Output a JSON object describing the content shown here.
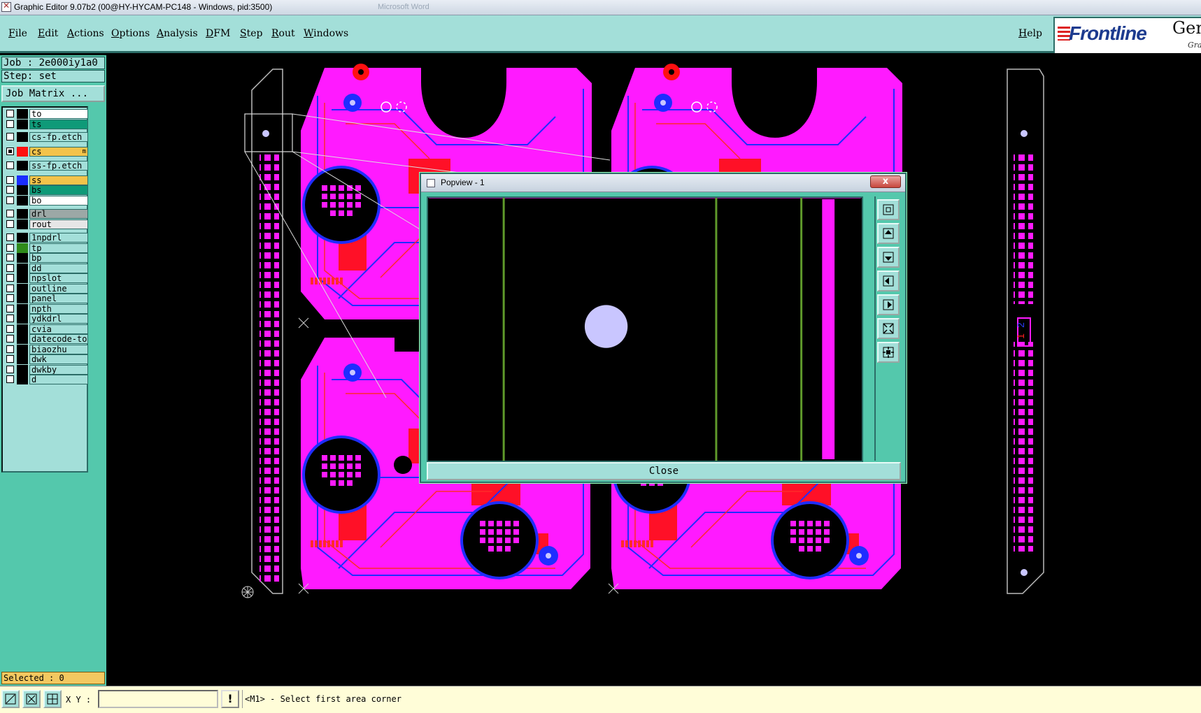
{
  "window": {
    "title": "Graphic Editor 9.07b2 (00@HY-HYCAM-PC148 - Windows, pid:3500)",
    "background_text": "Microsoft Word"
  },
  "menubar": {
    "items": [
      "File",
      "Edit",
      "Actions",
      "Options",
      "Analysis",
      "DFM",
      "Step",
      "Rout",
      "Windows"
    ],
    "help": "Help"
  },
  "logo": {
    "brand": "Frontline",
    "product": "Gen",
    "subtitle": "Gra"
  },
  "job": {
    "job_line": "Job : 2e000iy1a0",
    "step_line": "Step: set",
    "job_matrix_label": "Job Matrix ..."
  },
  "layers": [
    {
      "name": "to",
      "swatch": "#000000",
      "bg": "#ffffff",
      "checked": false
    },
    {
      "name": "ts",
      "swatch": "#000000",
      "bg": "#0f9a78",
      "checked": false
    },
    {
      "name": "cs-fp.etch",
      "swatch": "#000000",
      "bg": "#a3dfd9",
      "checked": false
    },
    {
      "name": "cs",
      "swatch": "#ff1010",
      "bg": "#f3c34a",
      "checked": true,
      "mark": "m"
    },
    {
      "name": "ss-fp.etch",
      "swatch": "#000000",
      "bg": "#a3dfd9",
      "checked": false
    },
    {
      "name": "ss",
      "swatch": "#1a2dff",
      "bg": "#f3c34a",
      "checked": false
    },
    {
      "name": "bs",
      "swatch": "#000000",
      "bg": "#0f9a78",
      "checked": false
    },
    {
      "name": "bo",
      "swatch": "#000000",
      "bg": "#ffffff",
      "checked": false
    },
    {
      "name": "drl",
      "swatch": "#000000",
      "bg": "#9ca8a6",
      "checked": false
    },
    {
      "name": "rout",
      "swatch": "#000000",
      "bg": "#e6e6e6",
      "checked": false
    },
    {
      "name": "1npdrl",
      "swatch": "#000000",
      "bg": "#a3dfd9",
      "checked": false
    },
    {
      "name": "tp",
      "swatch": "#2f8b1a",
      "bg": "#a3dfd9",
      "checked": false
    },
    {
      "name": "bp",
      "swatch": "#000000",
      "bg": "#a3dfd9",
      "checked": false
    },
    {
      "name": "dd",
      "swatch": "#000000",
      "bg": "#a3dfd9",
      "checked": false
    },
    {
      "name": "npslot",
      "swatch": "#000000",
      "bg": "#a3dfd9",
      "checked": false
    },
    {
      "name": "outline",
      "swatch": "#000000",
      "bg": "#a3dfd9",
      "checked": false
    },
    {
      "name": "panel",
      "swatch": "#000000",
      "bg": "#a3dfd9",
      "checked": false
    },
    {
      "name": "npth",
      "swatch": "#000000",
      "bg": "#a3dfd9",
      "checked": false
    },
    {
      "name": "ydkdrl",
      "swatch": "#000000",
      "bg": "#a3dfd9",
      "checked": false
    },
    {
      "name": "cvia",
      "swatch": "#000000",
      "bg": "#a3dfd9",
      "checked": false
    },
    {
      "name": "datecode-to",
      "swatch": "#000000",
      "bg": "#a3dfd9",
      "checked": false
    },
    {
      "name": "biaozhu",
      "swatch": "#000000",
      "bg": "#a3dfd9",
      "checked": false
    },
    {
      "name": "dwk",
      "swatch": "#000000",
      "bg": "#a3dfd9",
      "checked": false
    },
    {
      "name": "dwkby",
      "swatch": "#000000",
      "bg": "#a3dfd9",
      "checked": false
    },
    {
      "name": "d",
      "swatch": "#000000",
      "bg": "#a3dfd9",
      "checked": false
    }
  ],
  "status": {
    "selected": "Selected : 0"
  },
  "bottombar": {
    "xy_label": "X Y :",
    "xy_value": "",
    "warn": "!",
    "prompt": "<M1> - Select first area corner"
  },
  "board": {
    "label_1": "1",
    "label_2": "2"
  },
  "popview": {
    "title": "Popview - 1",
    "close_glyph": "x",
    "close_button": "Close"
  },
  "colors": {
    "panel": "#54c8ac",
    "menu": "#a3dfd9",
    "copper_top": "#ff1aff",
    "copper_bottom": "#ff1010",
    "trace_blue": "#1f2dff",
    "drill": "#c9c6ff"
  }
}
